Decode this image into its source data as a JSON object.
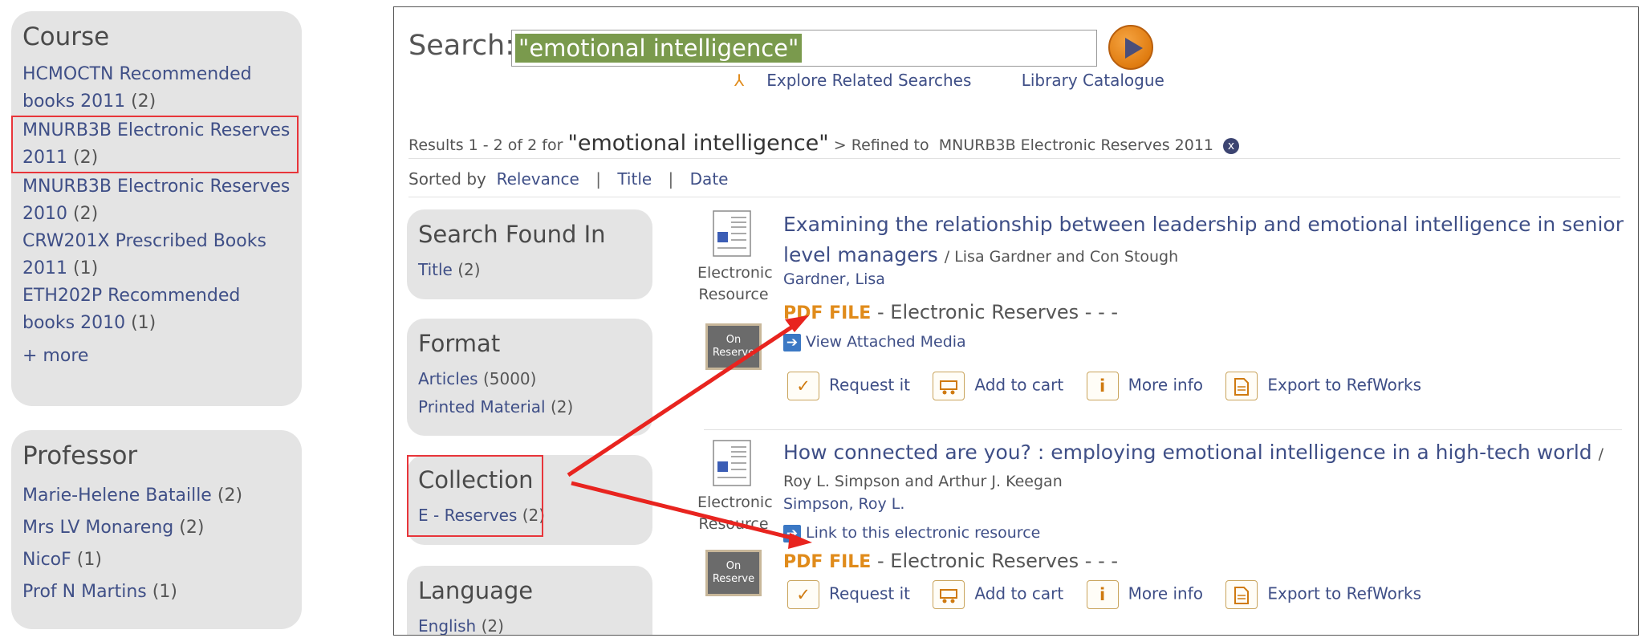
{
  "course": {
    "heading": "Course",
    "items": [
      {
        "label": "HCMOCTN Recommended books 2011",
        "count": "(2)"
      },
      {
        "label": "MNURB3B Electronic Reserves 2011",
        "count": "(2)"
      },
      {
        "label": "MNURB3B Electronic Reserves 2010",
        "count": "(2)"
      },
      {
        "label": "CRW201X Prescribed Books 2011",
        "count": "(1)"
      },
      {
        "label": "ETH202P Recommended books 2010",
        "count": "(1)"
      }
    ],
    "more": "+ more"
  },
  "professor": {
    "heading": "Professor",
    "items": [
      {
        "label": "Marie-Helene Bataille",
        "count": "(2)"
      },
      {
        "label": "Mrs LV Monareng",
        "count": "(2)"
      },
      {
        "label": "NicoF",
        "count": "(1)"
      },
      {
        "label": "Prof N Martins",
        "count": "(1)"
      }
    ]
  },
  "search": {
    "label": "Search:",
    "value": "\"emotional intelligence\"",
    "explore_label": "Explore Related Searches",
    "catalogue_label": "Library Catalogue"
  },
  "results": {
    "prefix": "Results 1 - 2 of 2 for",
    "query": "\"emotional intelligence\"",
    "refined_prefix": "> Refined to",
    "refined_value": "MNURB3B Electronic Reserves 2011",
    "remove_icon": "x"
  },
  "sort": {
    "prefix": "Sorted by",
    "relevance": "Relevance",
    "title": "Title",
    "date": "Date",
    "separator": "|"
  },
  "facets": {
    "found_in": {
      "heading": "Search Found In",
      "items": [
        {
          "label": "Title",
          "count": "(2)"
        }
      ]
    },
    "format": {
      "heading": "Format",
      "items": [
        {
          "label": "Articles",
          "count": "(5000)"
        },
        {
          "label": "Printed Material",
          "count": "(2)"
        }
      ]
    },
    "collection": {
      "heading": "Collection",
      "items": [
        {
          "label": "E - Reserves",
          "count": "(2)"
        }
      ]
    },
    "language": {
      "heading": "Language",
      "items": [
        {
          "label": "English",
          "count": "(2)"
        }
      ]
    }
  },
  "records": [
    {
      "type_label": "Electronic Resource",
      "title": "Examining the relationship between leadership and emotional intelligence in senior level managers",
      "by": "/ Lisa Gardner and Con Stough",
      "author": "Gardner, Lisa",
      "format": "PDF FILE",
      "format_rest": "-  Electronic Reserves -  -  -",
      "media_link": "View Attached Media",
      "badge": "On Reserve"
    },
    {
      "type_label": "Electronic Resource",
      "title": "How connected are you? : employing emotional intelligence in a high-tech world",
      "by": "/",
      "responsibility": "Roy L. Simpson and Arthur J. Keegan",
      "author": "Simpson, Roy L.",
      "media_link": "Link to this electronic resource",
      "format": "PDF FILE",
      "format_rest": "-  Electronic Reserves -  -  -",
      "badge": "On Reserve"
    }
  ],
  "actions": {
    "request": "Request it",
    "cart": "Add to cart",
    "info": "More info",
    "export": "Export to RefWorks",
    "info_glyph": "i",
    "request_glyph": "✓"
  },
  "colors": {
    "link": "#3f4f87",
    "accent_orange": "#e08b1b",
    "highlight_red": "#e8353a",
    "panel_gray": "#e4e4e4",
    "selection_green": "#7a9a4d"
  }
}
